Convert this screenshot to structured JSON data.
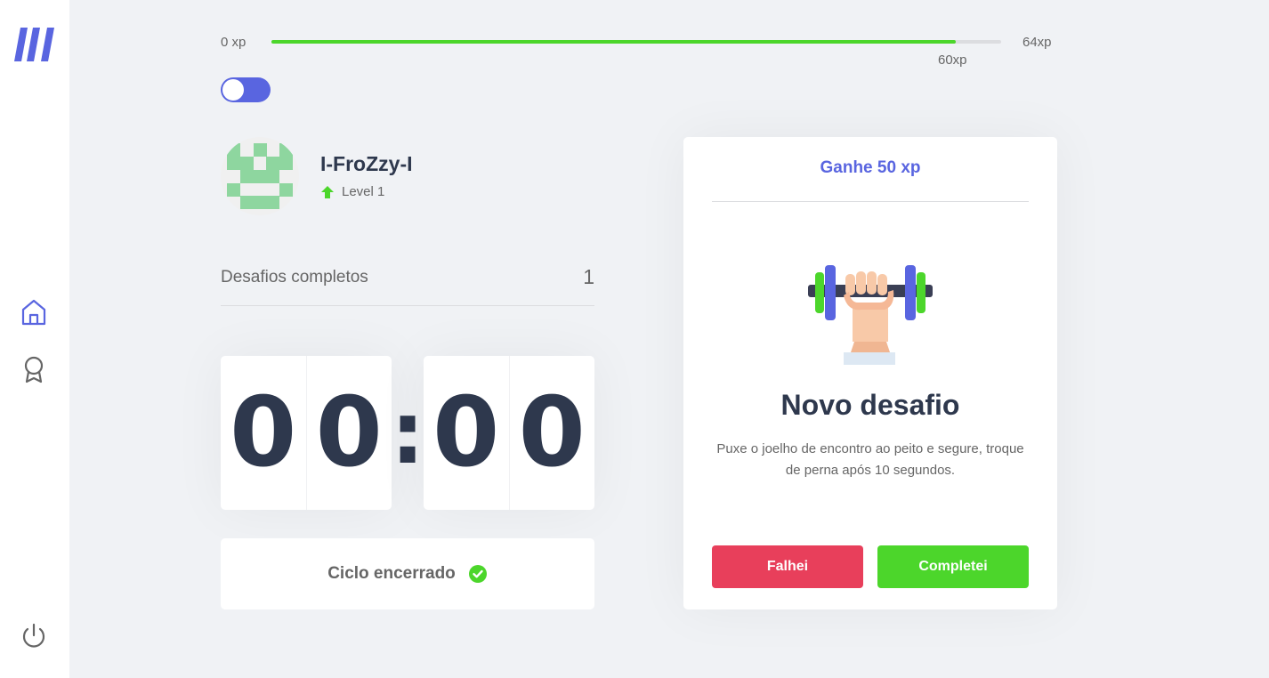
{
  "xp": {
    "start_label": "0 xp",
    "end_label": "64xp",
    "current_label": "60xp",
    "current": 60,
    "max": 64
  },
  "theme_toggle": {
    "on": true
  },
  "profile": {
    "name": "I-FroZzy-I",
    "level_label": "Level 1"
  },
  "challenges": {
    "label": "Desafios completos",
    "count": "1"
  },
  "countdown": {
    "minute_left": "0",
    "minute_right": "0",
    "separator": ":",
    "second_left": "0",
    "second_right": "0"
  },
  "cycle": {
    "label": "Ciclo encerrado"
  },
  "challenge_card": {
    "header": "Ganhe 50 xp",
    "title": "Novo desafio",
    "description": "Puxe o joelho de encontro ao peito e segure, troque de perna após 10 segundos.",
    "fail_label": "Falhei",
    "complete_label": "Completei"
  },
  "icons": {
    "logo": "logo-icon",
    "home": "home-icon",
    "award": "award-icon",
    "power": "power-icon",
    "level_up": "arrow-up-icon",
    "check": "check-circle-icon"
  },
  "colors": {
    "accent": "#5965e0",
    "green": "#4cd62b",
    "red": "#e83f5b",
    "title": "#2e384d",
    "text": "#666666",
    "background": "#f0f2f5"
  }
}
